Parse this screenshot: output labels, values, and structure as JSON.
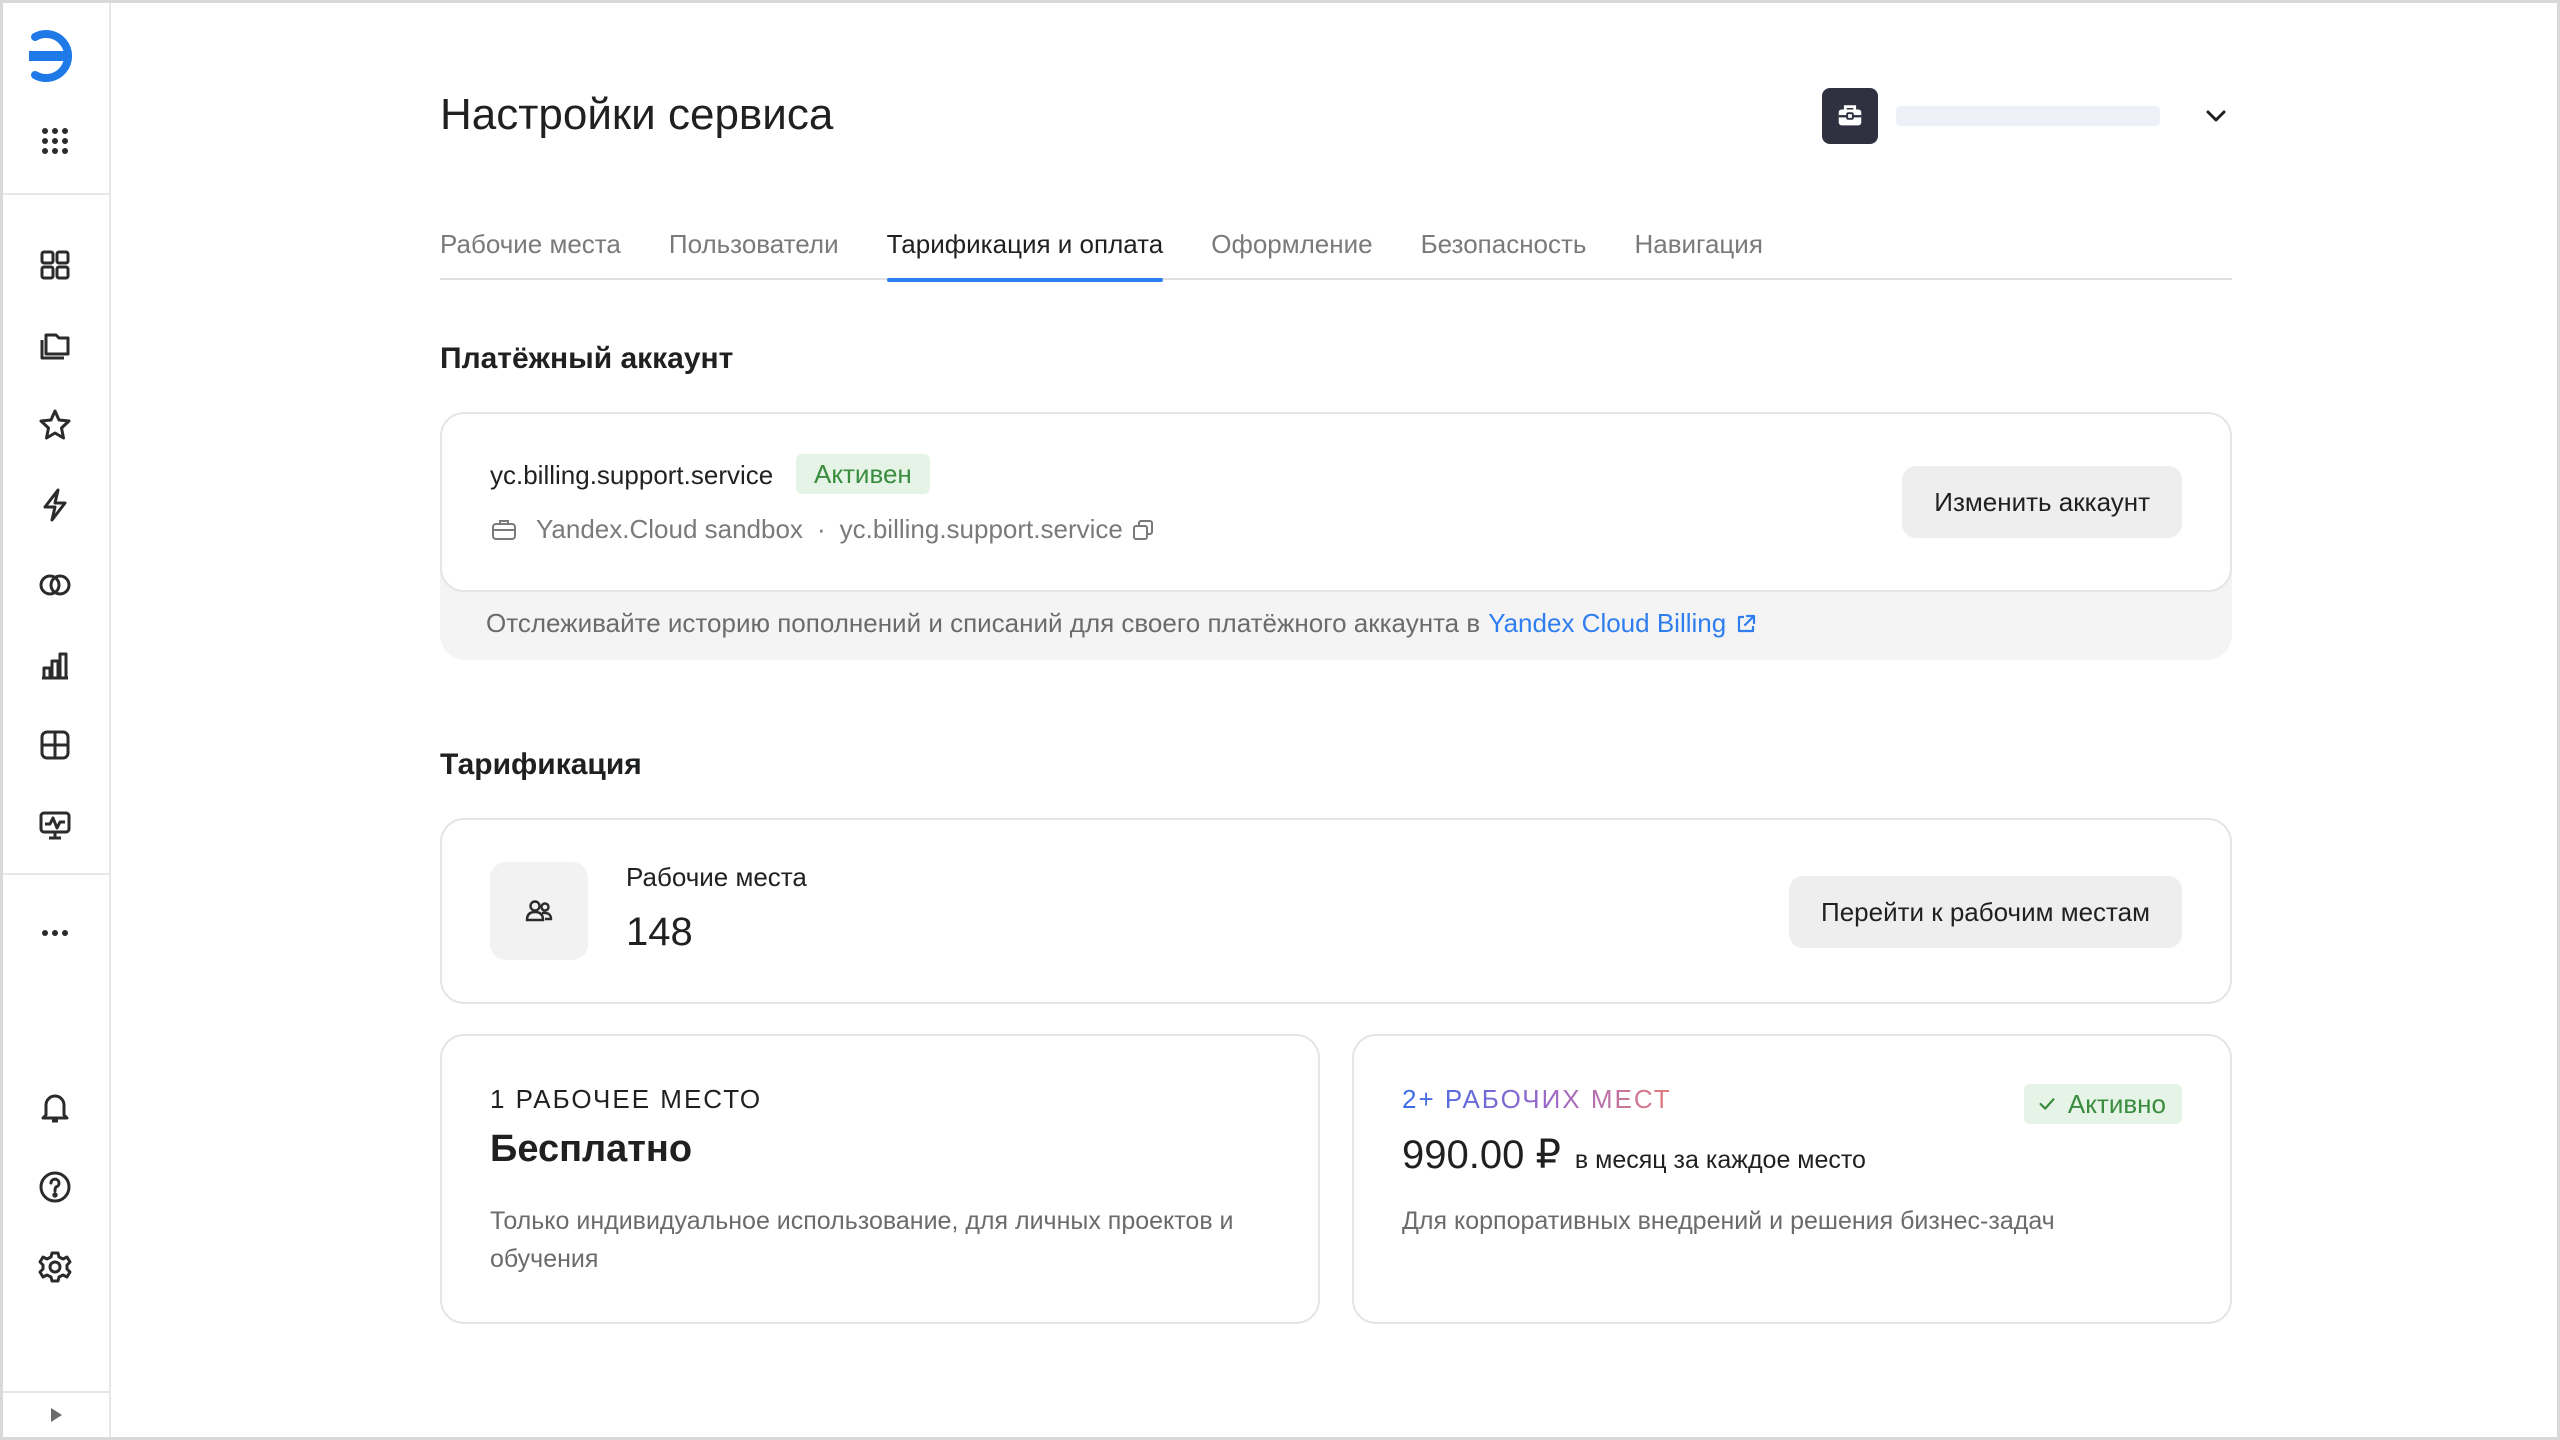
{
  "header": {
    "title": "Настройки сервиса"
  },
  "tabs": [
    {
      "label": "Рабочие места",
      "active": false
    },
    {
      "label": "Пользователи",
      "active": false
    },
    {
      "label": "Тарификация и оплата",
      "active": true
    },
    {
      "label": "Оформление",
      "active": false
    },
    {
      "label": "Безопасность",
      "active": false
    },
    {
      "label": "Навигация",
      "active": false
    }
  ],
  "billing": {
    "section_title": "Платёжный аккаунт",
    "account_name": "yc.billing.support.service",
    "status": "Активен",
    "cloud_name": "Yandex.Cloud sandbox",
    "separator": "·",
    "account_id": "yc.billing.support.service",
    "change_button": "Изменить аккаунт",
    "note": "Отслеживайте историю пополнений и списаний для своего платёжного аккаунта в",
    "note_link": "Yandex Cloud Billing"
  },
  "tariff": {
    "section_title": "Тарификация",
    "seats_label": "Рабочие места",
    "seats_count": "148",
    "seats_button": "Перейти к рабочим местам",
    "plans": [
      {
        "tag": "1 РАБОЧЕЕ МЕСТО",
        "title": "Бесплатно",
        "description": "Только индивидуальное использование, для личных проектов и обучения"
      },
      {
        "tag": "2+ РАБОЧИХ МЕСТ",
        "price": "990.00 ₽",
        "price_unit": "в месяц за каждое место",
        "description": "Для корпоративных внедрений и решения бизнес-задач",
        "status": "Активно"
      }
    ]
  },
  "colors": {
    "accent": "#2f7ef0",
    "success_bg": "#e5f4e6",
    "success_text": "#3a8c3f",
    "workspace_avatar": "#2f3140"
  },
  "icons": {
    "sidebar_top": [
      "datalens-logo-icon",
      "apps-grid-icon"
    ],
    "sidebar_nav": [
      "dashboards-icon",
      "collections-icon",
      "favorites-star-icon",
      "quick-actions-bolt-icon",
      "connections-icon",
      "charts-icon",
      "datasets-icon",
      "monitoring-icon",
      "more-icon"
    ],
    "sidebar_bottom": [
      "notifications-bell-icon",
      "help-icon",
      "settings-gear-icon",
      "expand-sidebar-icon"
    ]
  }
}
